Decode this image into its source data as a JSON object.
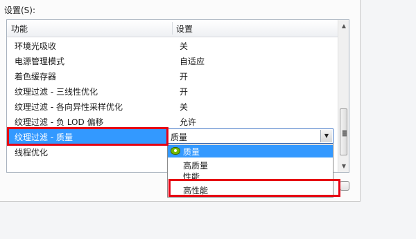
{
  "section_label": "设置(S):",
  "table": {
    "headers": {
      "feature": "功能",
      "setting": "设置"
    },
    "rows": [
      {
        "feature": "环境光吸收",
        "setting": "关"
      },
      {
        "feature": "电源管理模式",
        "setting": "自适应"
      },
      {
        "feature": "着色缓存器",
        "setting": "开"
      },
      {
        "feature": "纹理过滤 - 三线性优化",
        "setting": "开"
      },
      {
        "feature": "纹理过滤 - 各向异性采样优化",
        "setting": "关"
      },
      {
        "feature": "纹理过滤 - 负 LOD 偏移",
        "setting": "允许"
      },
      {
        "feature": "纹理过滤 - 质量",
        "setting": "质量"
      },
      {
        "feature": "线程优化",
        "setting": ""
      }
    ]
  },
  "dropdown": {
    "selected_value": "质量",
    "options": [
      "质量",
      "高质量",
      "性能",
      "高性能"
    ],
    "highlighted_option": "质量"
  },
  "colors": {
    "selection": "#3399ff",
    "annotation_red": "#e60012",
    "nvidia_green": "#76b900"
  },
  "icons": [
    "scroll-up-arrow-icon",
    "scroll-down-arrow-icon",
    "dropdown-arrow-icon",
    "nvidia-logo-icon"
  ]
}
